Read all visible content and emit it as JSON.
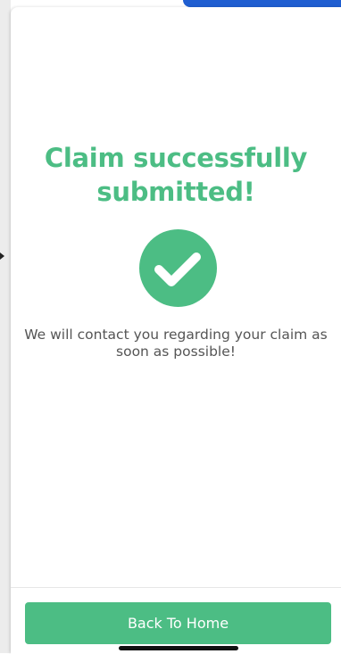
{
  "confirmation": {
    "title": "Claim successfully submitted!",
    "message": "We will contact you regarding your claim as soon as possible!",
    "icon": "checkmark-circle-icon"
  },
  "footer": {
    "back_button_label": "Back To Home"
  },
  "colors": {
    "accent": "#4cbd84",
    "header_blue": "#1f5ed1",
    "message_text": "#555555"
  }
}
